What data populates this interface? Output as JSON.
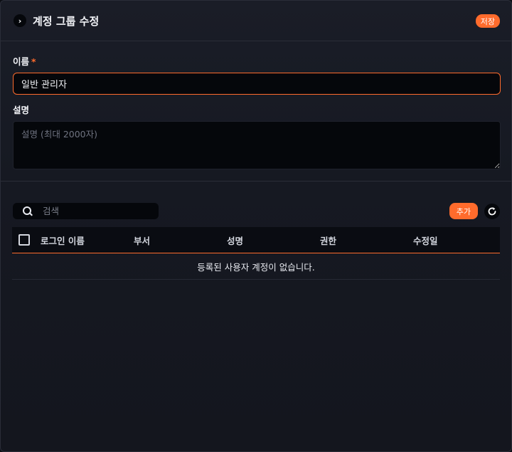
{
  "header": {
    "title": "계정 그룹 수정",
    "save_label": "저장"
  },
  "form": {
    "name_label": "이름",
    "required_mark": "*",
    "name_value": "일반 관리자",
    "desc_label": "설명",
    "desc_placeholder": "설명 (최대 2000자)"
  },
  "toolbar": {
    "search_placeholder": "검색",
    "add_label": "추가"
  },
  "table": {
    "columns": [
      "로그인 이름",
      "부서",
      "성명",
      "권한",
      "수정일"
    ],
    "empty_message": "등록된 사용자 계정이 없습니다."
  },
  "colors": {
    "accent": "#ff6b2c",
    "background": "#161922",
    "input_bg": "#05070b"
  }
}
